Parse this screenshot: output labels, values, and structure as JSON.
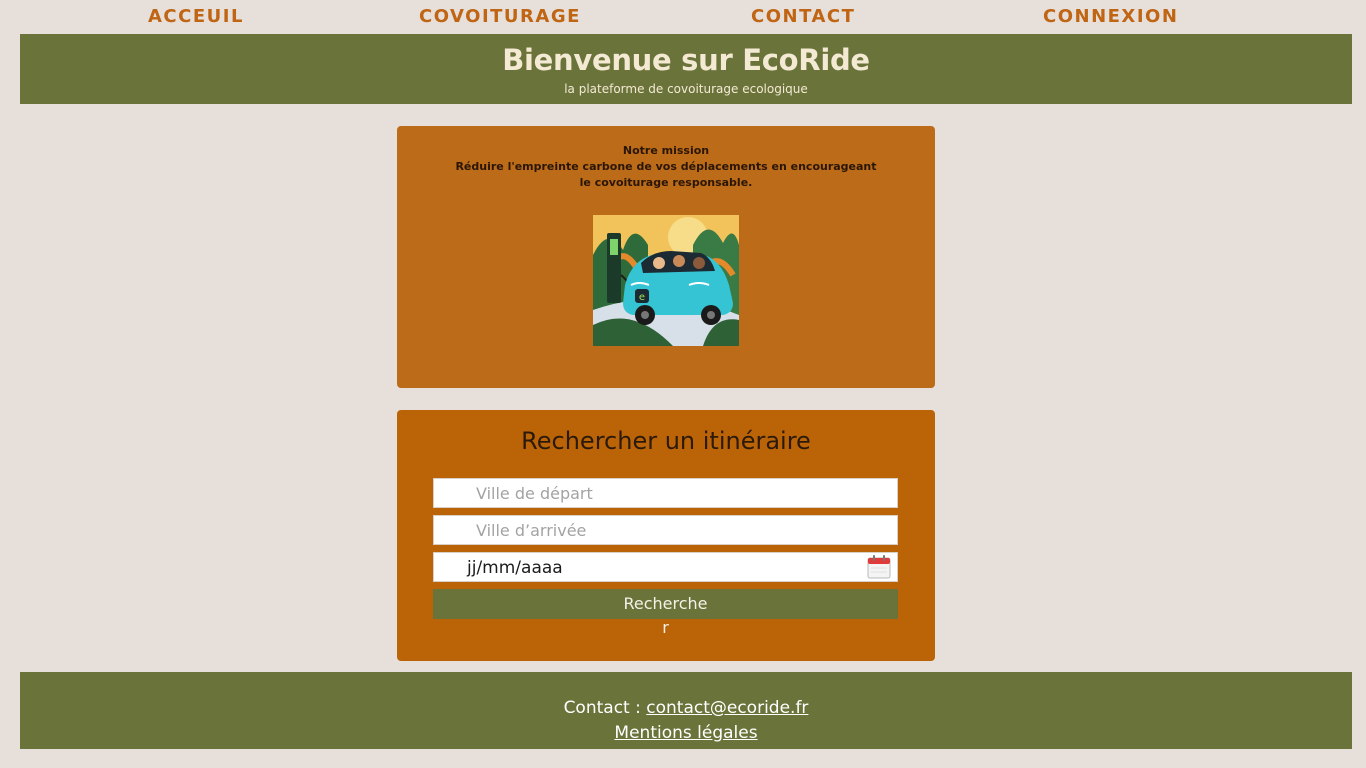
{
  "nav": {
    "items": [
      {
        "label": "ACCEUIL"
      },
      {
        "label": "COVOITURAGE"
      },
      {
        "label": "CONTACT"
      },
      {
        "label": "CONNEXION"
      }
    ]
  },
  "hero": {
    "title": "Bienvenue sur EcoRide",
    "subtitle": "la plateforme de covoiturage ecologique"
  },
  "mission": {
    "heading": "Notre mission",
    "text": "Réduire l'empreinte carbone de vos déplacements en encourageant le covoiturage responsable."
  },
  "search": {
    "title": "Rechercher un itinéraire",
    "departure_placeholder": "Ville de départ",
    "arrival_placeholder": "Ville d’arrivée",
    "date_value": "jj/mm/aaaa",
    "button_label_line1": "Recherche",
    "button_label_line2": "r"
  },
  "footer": {
    "contact_label": "Contact : ",
    "contact_email": "contact@ecoride.fr",
    "legal": "Mentions légales"
  },
  "colors": {
    "background": "#e7dfda",
    "olive": "#6a733a",
    "orange": "#bb6407",
    "nav_text": "#bf6513"
  },
  "icons": [
    "calendar-icon",
    "electric-car-illustration"
  ]
}
